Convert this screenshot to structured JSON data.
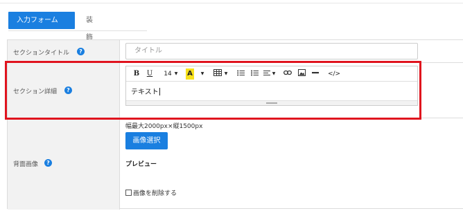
{
  "tabs": {
    "active_label": "入力フォーム",
    "inactive_label": "装飾設定"
  },
  "title_row": {
    "label": "セクションタイトル",
    "input_placeholder": "タイトル"
  },
  "detail_row": {
    "label": "セクション詳細",
    "toolbar": {
      "bold": "B",
      "underline": "U",
      "font_size": "14",
      "font_color": "A",
      "code": "</>"
    },
    "text": "テキスト"
  },
  "image_row": {
    "label": "背面画像",
    "size_note": "幅最大2000px×縦1500px",
    "select_button": "画像選択",
    "preview_label": "プレビュー",
    "delete_label": "画像を削除する",
    "delete_checked": false
  },
  "help_glyph": "?",
  "colors": {
    "accent": "#1a7fe0",
    "highlight": "#e0131e",
    "label_bg": "#f2f2f2",
    "font_color_swatch": "#f7e11c"
  }
}
